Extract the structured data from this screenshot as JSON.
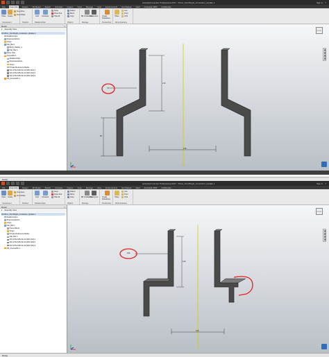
{
  "app": {
    "title": "Autodesk Inventor Professional 2017",
    "file_name": "Mirror_Part Bright_Constraint_Update 1",
    "sign_in": "Sign In",
    "help": "?"
  },
  "tabs": [
    "File",
    "Assemble",
    "Design",
    "3D Model",
    "Sketch",
    "Annotate",
    "Inspect",
    "Tools",
    "Manage",
    "View",
    "Environments",
    "Get Started",
    "Vault",
    "Autodesk A360",
    "Collaborate"
  ],
  "active_tab_index": 1,
  "ribbon": {
    "component": {
      "label": "Component",
      "place": "Place",
      "create": "Create",
      "free_move": "Free Move",
      "free_rotate": "Free Rotate"
    },
    "position": {
      "label": "Position"
    },
    "relationships": {
      "label": "Relationships",
      "joint": "Joint",
      "constrain": "Constrain",
      "show": "Show",
      "show_sick": "Show Sick",
      "hide_all": "Hide All"
    },
    "pattern": {
      "label": "Pattern",
      "pattern": "Pattern",
      "mirror": "Mirror",
      "copy": "Copy"
    },
    "manage": {
      "label": "Manage",
      "bill_of_materials": "Bill of Materials",
      "parameters": "Parameters"
    },
    "productivity": {
      "label": "Productivity",
      "create_substitutes": "Create Substitutes"
    },
    "work_features": {
      "label": "Work Features",
      "plane": "Plane",
      "axis": "Axis",
      "point": "Point",
      "ucs": "UCS"
    }
  },
  "browser": {
    "header": "Model",
    "view_label": "Assembly View",
    "top_items": [
      "Mirror_Part Bright_Constraint_Update 1",
      "Relationships",
      "Representations",
      "Origin",
      "Flat_Bar:1",
      "Bend_Radius_1",
      "Flat_Bar:1",
      "Mirror Part",
      "Frame001:1",
      "Relationships",
      "Representations",
      "Origin",
      "Private Reference Model",
      "ISO 4762-M5x10-A2 [DIN 912]:1",
      "ISO 4762-M5x10-A2 [DIN 912]:2",
      "ISO 4762-M5x10-A2 [DIN 912]:3",
      "MS_Frame001:1"
    ],
    "bottom_items": [
      "Mirror_Part Bright_Constraint_Update 1",
      "Relationships",
      "Representations",
      "Origin",
      "Flat_Bar:1",
      "Frame:Bend",
      "Origin",
      "Private Reference Model",
      "Flat_Bar:1",
      "ISO 4762-M5x10-A2 [DIN 912]:1",
      "ISO 4762-M5x10-A2 [DIN 912]:2",
      "ISO 4762-M5x10-A2 [DIN 912]:3",
      "MS_Frame001:1"
    ]
  },
  "top_view": {
    "dims": {
      "small": "70",
      "tall": "170",
      "left_vertical": "80",
      "bottom": "130"
    }
  },
  "bottom_view": {
    "dims": {
      "small": "100",
      "tall": "120",
      "bottom": "120"
    }
  },
  "status": {
    "text": "Ready"
  },
  "colors": {
    "annotation": "#e02020",
    "accent": "#d34a20",
    "part": "#4a4a4a",
    "axis": "#c9d400"
  },
  "icons": {
    "view_cube": "view-cube-icon",
    "nav_bar": "navigation-bar-icon",
    "triad": "coordinate-triad-icon",
    "app_logo": "inventor-logo-icon"
  }
}
